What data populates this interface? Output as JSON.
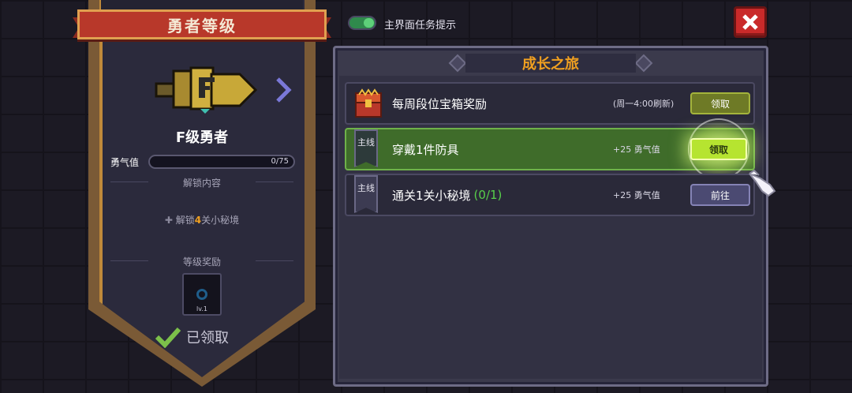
{
  "left_panel": {
    "title": "勇者等级",
    "rank_name": "F级勇者",
    "courage_label": "勇气值",
    "courage_value": "0/75",
    "courage_progress": 0,
    "unlock_section_label": "解锁内容",
    "unlock_prefix": "解锁",
    "unlock_count": "4",
    "unlock_suffix": "关小秘境",
    "reward_section_label": "等级奖励",
    "reward_level": "lv.1",
    "claimed_text": "已领取"
  },
  "header": {
    "toggle_label": "主界面任务提示",
    "toggle_on": true
  },
  "panel": {
    "title": "成长之旅",
    "tasks": [
      {
        "tag": "",
        "title": "每周段位宝箱奖励",
        "progress": "",
        "reward": "(周一4:00刷新)",
        "button": "领取",
        "state": "claim"
      },
      {
        "tag": "主线",
        "title": "穿戴1件防具",
        "progress": "",
        "reward": "+25 勇气值",
        "button": "领取",
        "state": "claim-highlight"
      },
      {
        "tag": "主线",
        "title": "通关1关小秘境",
        "progress": "(0/1)",
        "reward": "+25 勇气值",
        "button": "前往",
        "state": "go"
      }
    ]
  },
  "colors": {
    "accent_orange": "#f0a020",
    "ribbon_red": "#b8382a",
    "active_green": "#3f6c2a",
    "close_red": "#c92a2a"
  }
}
